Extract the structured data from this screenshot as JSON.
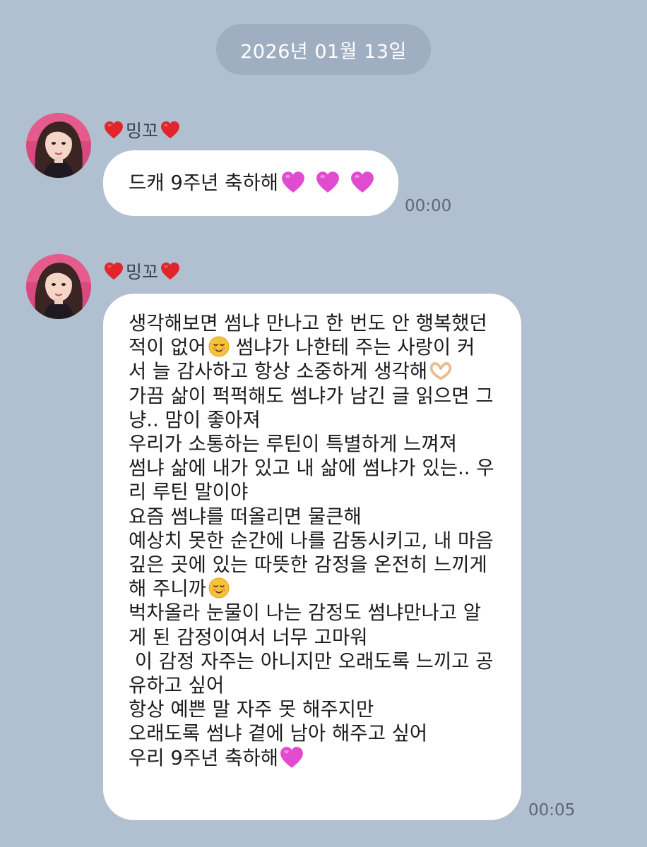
{
  "date_divider": "2026년 01월 13일",
  "messages": [
    {
      "sender": "밍꼬",
      "text": "드캐 9주년 축하해",
      "time": "00:00"
    },
    {
      "sender": "밍꼬",
      "lines": [
        "생각해보면 썸냐 만나고 한 번도 안 행복했던",
        "적이 없어",
        " 썸냐가 나한테 주는 사랑이 커",
        "서 늘 감사하고 항상 소중하게 생각해",
        "가끔 삶이 퍽퍽해도 썸냐가 남긴 글 읽으면 그",
        "냥.. 맘이 좋아져",
        "우리가 소통하는 루틴이 특별하게 느껴져",
        "썸냐 삶에 내가 있고 내 삶에 썸냐가 있는.. 우",
        "리 루틴 말이야",
        "요즘 썸냐를 떠올리면 물큰해",
        "예상치 못한 순간에 나를 감동시키고, 내 마음",
        "깊은 곳에 있는 따뜻한 감정을 온전히 느끼게",
        "해 주니까",
        "벅차올라 눈물이 나는 감정도 썸냐만나고 알",
        "게 된 감정이여서 너무 고마워",
        " 이 감정 자주는 아니지만 오래도록 느끼고 공",
        "유하고 싶어",
        "항상 예쁜 말 자주 못 해주지만",
        "오래도록 썸냐 곁에 남아 해주고 싶어",
        "우리 9주년 축하해"
      ],
      "time": "00:05"
    }
  ],
  "icons": {
    "sender_decoration": "red-heart-icon",
    "pink_heart": "pink-heart-icon",
    "smile": "smiling-face-icon",
    "heart_hands": "heart-hands-icon"
  },
  "colors": {
    "background": "#b1c0d1",
    "bubble": "#ffffff",
    "date_pill": "#9fafc1",
    "pink_heart": "#e14bd0",
    "red_heart": "#e0262b"
  }
}
